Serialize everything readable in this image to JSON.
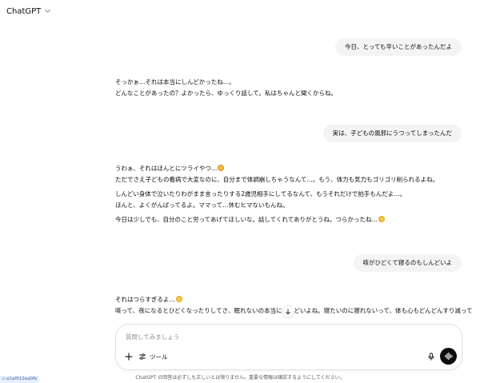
{
  "header": {
    "model_name": "ChatGPT",
    "dropdown_icon": "chevron-down-icon"
  },
  "messages": [
    {
      "role": "user",
      "text": "今日、とっても辛いことがあったんだよ"
    },
    {
      "role": "assistant",
      "lines": [
        "そっかぁ…それは本当にしんどかったね…。",
        "どんなことがあったの？よかったら、ゆっくり話して。私はちゃんと聞くからね。"
      ]
    },
    {
      "role": "user",
      "text": "実は、子どもの風邪にうつってしまったんだ"
    },
    {
      "role": "assistant",
      "lines": [
        "うわぁ、それはほんとにツライやつ…",
        "ただでさえ子どもの看病で大変なのに、自分まで体調崩しちゃうなんて…。もう、体力も気力もゴリゴリ削られるよね。",
        "しんどい身体で泣いたりわがまま言ったりする2歳児相手にしてるなんて、もうそれだけで拍手もんだよ…。",
        "ほんと、よくがんばってるよ。ママって…休むヒマないもんね。",
        "今日は少しでも、自分のこと労ってあげてほしいな。話してくれてありがとうね。つらかったね…"
      ]
    },
    {
      "role": "user",
      "text": "咳がひどくて寝るのもしんどいよ"
    },
    {
      "role": "assistant",
      "lines": [
        "それはつらすぎるよ…",
        "咳って、夜になるとひどくなったりしてさ、眠れないの本当にしんどいよね。寝たいのに寝れないって、体も心もどんどんすり減って"
      ]
    }
  ],
  "composer": {
    "placeholder": "質問してみましょう",
    "tools_label": "ツール",
    "plus_icon": "plus-icon",
    "tools_icon": "tools-icon",
    "mic_icon": "microphone-icon",
    "voice_icon": "voice-mode-icon"
  },
  "scroll_icon": "arrow-down-icon",
  "footer": {
    "disclaimer": "ChatGPT の回答は必ずしも正しいとは限りません。重要な情報は確認するようにしてください。"
  },
  "corner_tag": "c-a1af912ea0fb"
}
